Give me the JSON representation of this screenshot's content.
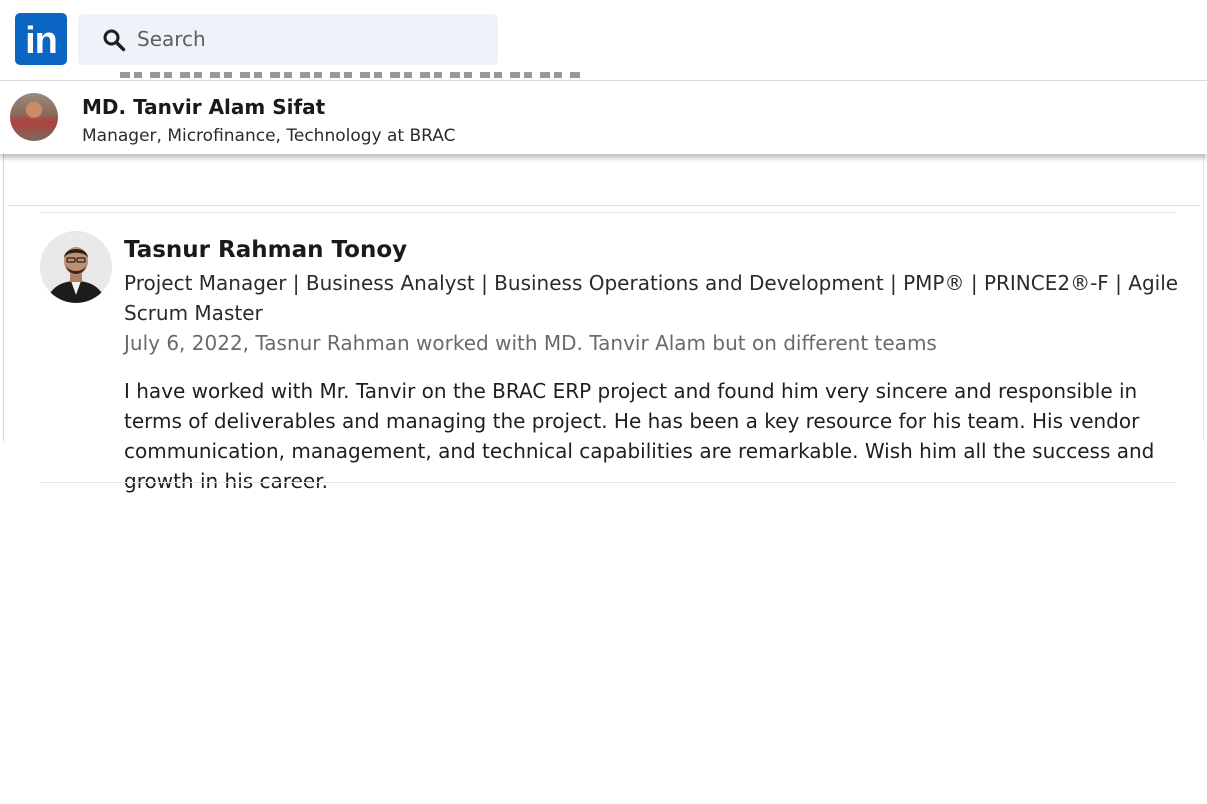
{
  "topbar": {
    "logo_text": "in",
    "search_placeholder": "Search"
  },
  "profile": {
    "name": "MD. Tanvir Alam Sifat",
    "headline": "Manager, Microfinance, Technology at BRAC"
  },
  "recommendation": {
    "author_name": "Tasnur Rahman Tonoy",
    "author_headline": "Project Manager | Business Analyst | Business Operations and Development | PMP® | PRINCE2®-F | Agile Scrum Master",
    "meta": "July 6, 2022, Tasnur Rahman worked with MD. Tanvir Alam but on different teams",
    "text": "I have worked with Mr. Tanvir on the BRAC ERP project and found him very sincere and responsible in terms of deliverables and managing the project. He has been a key resource for his team. His vendor communication, management, and technical capabilities are remarkable. Wish him all the success and growth in his career."
  },
  "colors": {
    "brand": "#0a66c2",
    "search_bg": "#edf3f8"
  }
}
